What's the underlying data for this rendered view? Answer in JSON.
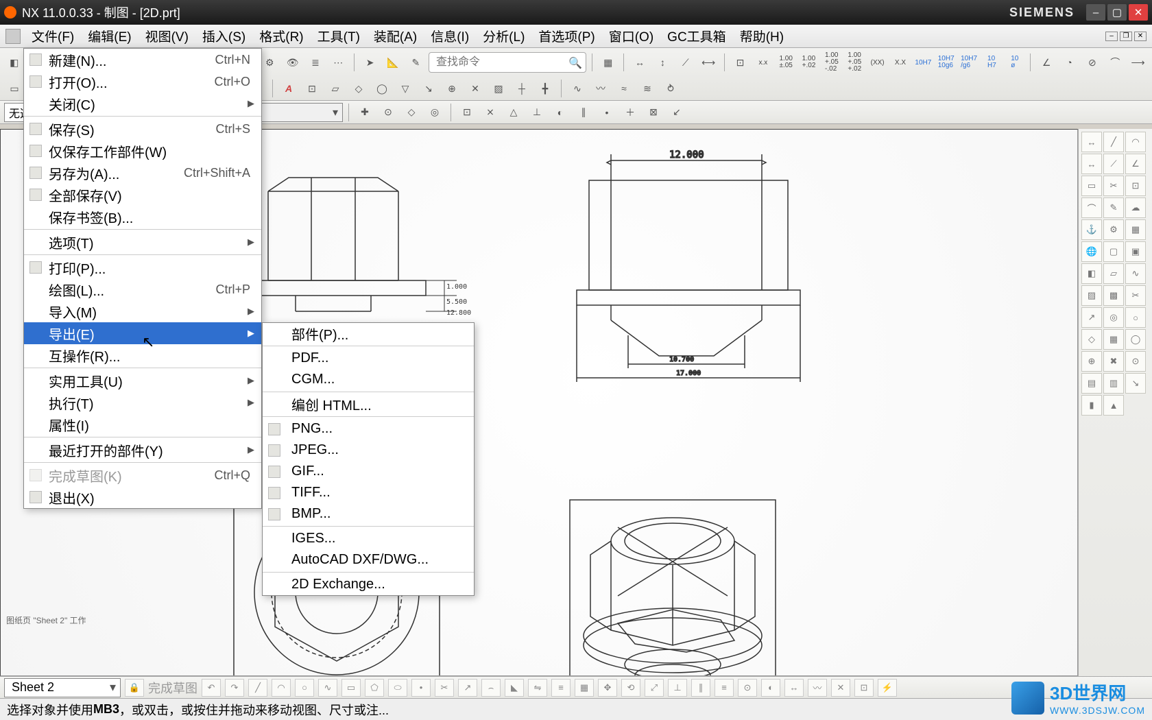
{
  "title": "NX 11.0.0.33 - 制图 - [2D.prt]",
  "brand": "SIEMENS",
  "menubar": [
    "文件(F)",
    "编辑(E)",
    "视图(V)",
    "插入(S)",
    "格式(R)",
    "工具(T)",
    "装配(A)",
    "信息(I)",
    "分析(L)",
    "首选项(P)",
    "窗口(O)",
    "GC工具箱",
    "帮助(H)"
  ],
  "search_placeholder": "查找命令",
  "tolerance_labels": [
    "1.00\n±.05",
    "1.00\n+.02",
    "1.00\n+.05\n-.02",
    "1.00\n+.05\n+.02"
  ],
  "tol_text": [
    "(XX)",
    "X.X",
    "10H7",
    "10H7\n10g6",
    "10H7\n/g6",
    "10\nH7",
    "10\nø"
  ],
  "sel_filter": "无选...",
  "sel_combo2": "",
  "file_menu": [
    {
      "icon": true,
      "label": "新建(N)...",
      "shortcut": "Ctrl+N"
    },
    {
      "icon": true,
      "label": "打开(O)...",
      "shortcut": "Ctrl+O"
    },
    {
      "label": "关闭(C)",
      "arrow": true
    },
    {
      "sep": true
    },
    {
      "icon": true,
      "label": "保存(S)",
      "shortcut": "Ctrl+S"
    },
    {
      "icon": true,
      "label": "仅保存工作部件(W)"
    },
    {
      "icon": true,
      "label": "另存为(A)...",
      "shortcut": "Ctrl+Shift+A"
    },
    {
      "icon": true,
      "label": "全部保存(V)"
    },
    {
      "label": "保存书签(B)..."
    },
    {
      "sep": true
    },
    {
      "label": "选项(T)",
      "arrow": true
    },
    {
      "sep": true
    },
    {
      "icon": true,
      "label": "打印(P)..."
    },
    {
      "label": "绘图(L)...",
      "shortcut": "Ctrl+P"
    },
    {
      "label": "导入(M)",
      "arrow": true
    },
    {
      "label": "导出(E)",
      "arrow": true,
      "hl": true
    },
    {
      "label": "互操作(R)..."
    },
    {
      "sep": true
    },
    {
      "label": "实用工具(U)",
      "arrow": true
    },
    {
      "label": "执行(T)",
      "arrow": true
    },
    {
      "label": "属性(I)"
    },
    {
      "sep": true
    },
    {
      "label": "最近打开的部件(Y)",
      "arrow": true
    },
    {
      "sep": true
    },
    {
      "icon": true,
      "label": "完成草图(K)",
      "shortcut": "Ctrl+Q",
      "disabled": true
    },
    {
      "icon": true,
      "label": "退出(X)"
    }
  ],
  "export_menu": [
    {
      "label": "部件(P)..."
    },
    {
      "sep": true
    },
    {
      "label": "PDF..."
    },
    {
      "label": "CGM..."
    },
    {
      "sep": true
    },
    {
      "label": "编创 HTML..."
    },
    {
      "sep": true
    },
    {
      "icon": true,
      "label": "PNG..."
    },
    {
      "icon": true,
      "label": "JPEG..."
    },
    {
      "icon": true,
      "label": "GIF..."
    },
    {
      "icon": true,
      "label": "TIFF..."
    },
    {
      "icon": true,
      "label": "BMP..."
    },
    {
      "sep": true
    },
    {
      "label": "IGES..."
    },
    {
      "label": "AutoCAD DXF/DWG..."
    },
    {
      "sep": true
    },
    {
      "label": "2D Exchange..."
    }
  ],
  "dimensions": {
    "d12": "12.000",
    "d1": "1.000",
    "d55": "5.500",
    "d128": "12.800",
    "d107": "10.700",
    "d17": "17.000"
  },
  "sheet_note": "图纸页 \"Sheet 2\" 工作",
  "sheet_combo": "Sheet 2",
  "bottom_disabled": "完成草图",
  "status_pre": "选择对象并使用 ",
  "status_bold": "MB3",
  "status_post": "，或双击，或按住并拖动来移动视图、尺寸或注...",
  "watermark": {
    "title": "3D世界网",
    "url": "WWW.3DSJW.COM"
  }
}
